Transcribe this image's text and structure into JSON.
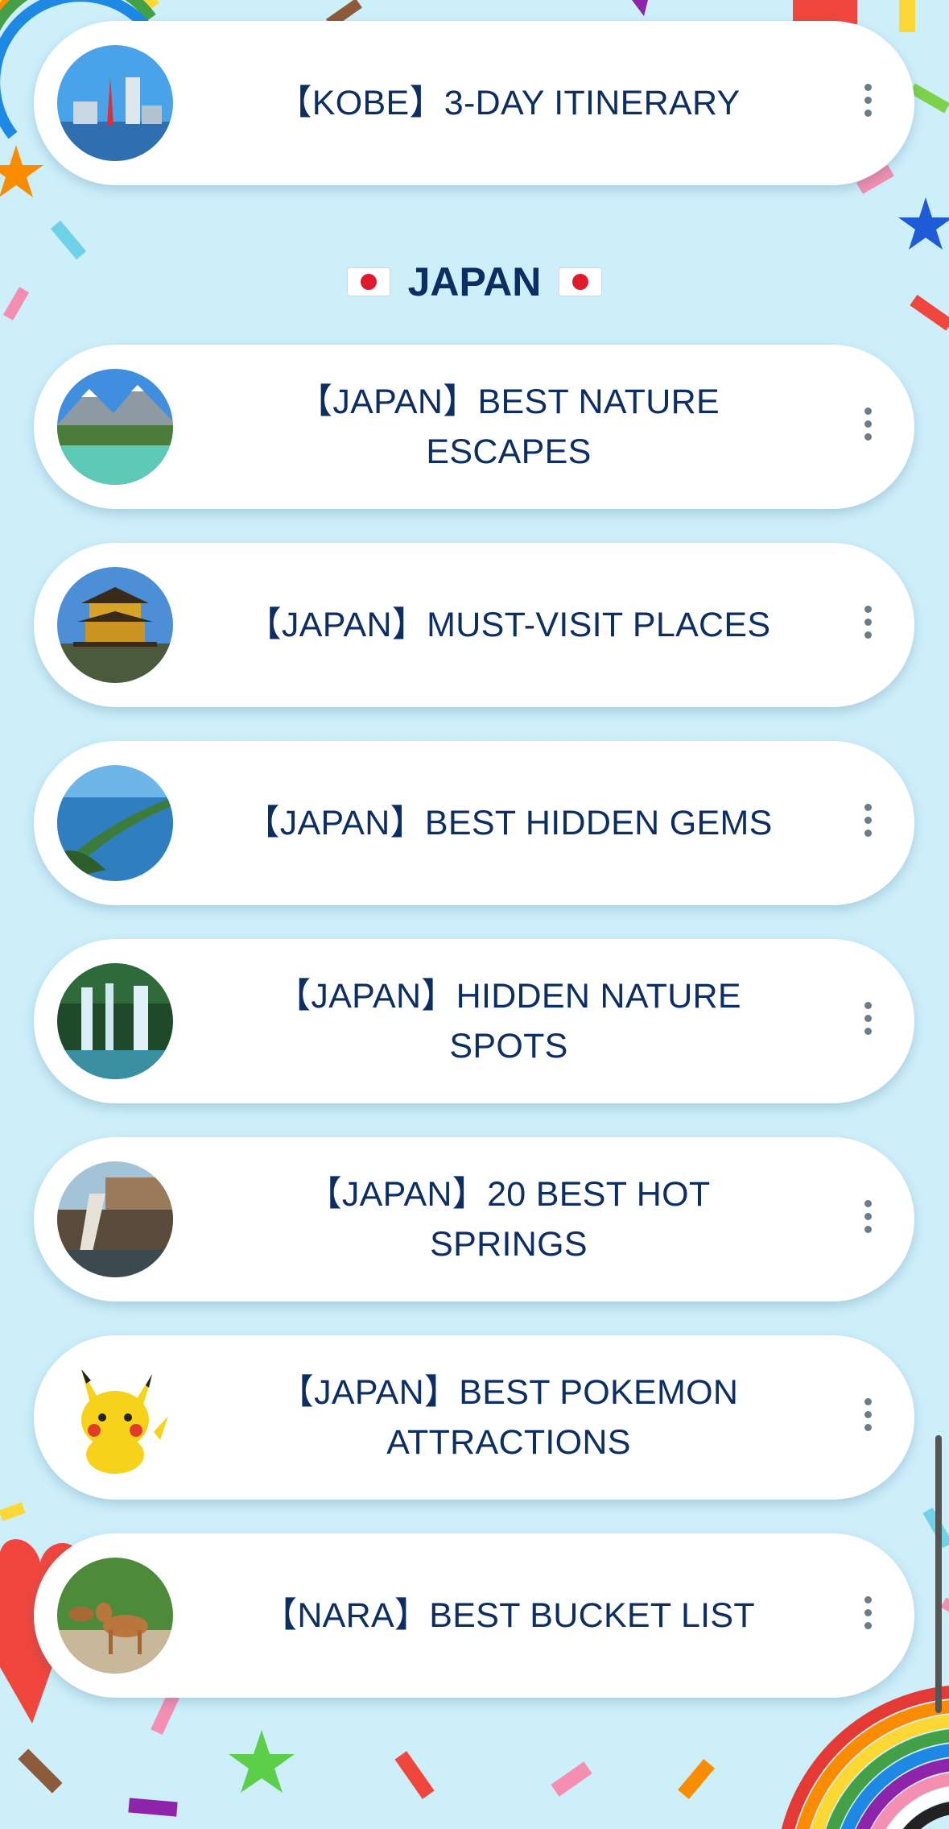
{
  "top_card": {
    "title": "【KOBE】3-DAY ITINERARY",
    "image": "kobe-port-tower-photo"
  },
  "section": {
    "title": "JAPAN",
    "flag_icon": "japan-flag-icon"
  },
  "cards": [
    {
      "lines": [
        "【JAPAN】BEST NATURE",
        "ESCAPES"
      ],
      "image": "mountain-river-photo"
    },
    {
      "lines": [
        "【JAPAN】MUST-VISIT PLACES"
      ],
      "image": "golden-pavilion-photo"
    },
    {
      "lines": [
        "【JAPAN】BEST HIDDEN GEMS"
      ],
      "image": "sandbar-bay-photo"
    },
    {
      "lines": [
        "【JAPAN】HIDDEN NATURE",
        "SPOTS"
      ],
      "image": "waterfall-photo"
    },
    {
      "lines": [
        "【JAPAN】20 BEST HOT",
        "SPRINGS"
      ],
      "image": "hot-spring-photo"
    },
    {
      "lines": [
        "【JAPAN】BEST POKEMON",
        "ATTRACTIONS"
      ],
      "image": "pikachu-image"
    },
    {
      "lines": [
        "【NARA】BEST BUCKET LIST"
      ],
      "image": "nara-deer-photo"
    }
  ],
  "colors": {
    "background": "#cdeffa",
    "text": "#0c2e63",
    "card": "#ffffff",
    "menu_dots": "#6d7c89"
  },
  "icons": {
    "more": "more-vertical-icon"
  }
}
